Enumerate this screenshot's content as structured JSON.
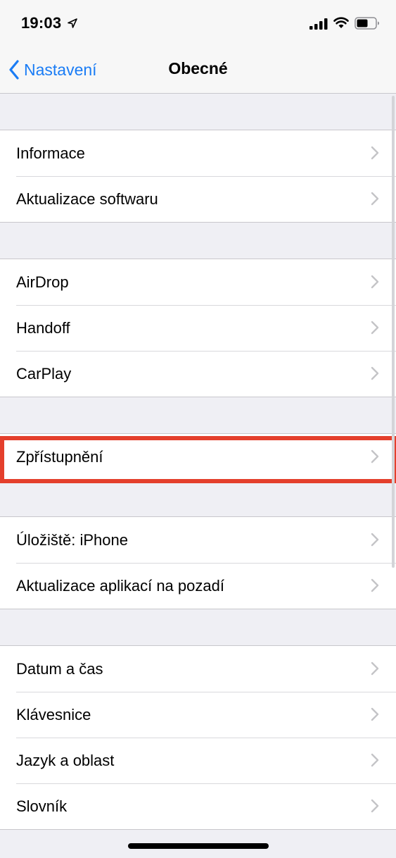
{
  "status_bar": {
    "time": "19:03",
    "icons": [
      "location-arrow-icon",
      "cellular-signal-icon",
      "wifi-icon",
      "battery-icon"
    ]
  },
  "nav": {
    "back_label": "Nastavení",
    "title": "Obecné"
  },
  "groups": [
    {
      "items": [
        {
          "label": "Informace"
        },
        {
          "label": "Aktualizace softwaru"
        }
      ]
    },
    {
      "items": [
        {
          "label": "AirDrop"
        },
        {
          "label": "Handoff"
        },
        {
          "label": "CarPlay"
        }
      ]
    },
    {
      "items": [
        {
          "label": "Zpřístupnění",
          "highlighted": true
        }
      ]
    },
    {
      "items": [
        {
          "label": "Úložiště: iPhone"
        },
        {
          "label": "Aktualizace aplikací na pozadí"
        }
      ]
    },
    {
      "items": [
        {
          "label": "Datum a čas"
        },
        {
          "label": "Klávesnice"
        },
        {
          "label": "Jazyk a oblast"
        },
        {
          "label": "Slovník"
        }
      ]
    }
  ],
  "colors": {
    "accent": "#1a7cf5",
    "highlight": "#e43f2c",
    "background": "#efeff4",
    "separator": "#c8c7cc",
    "chevron": "#c4c4c7"
  }
}
